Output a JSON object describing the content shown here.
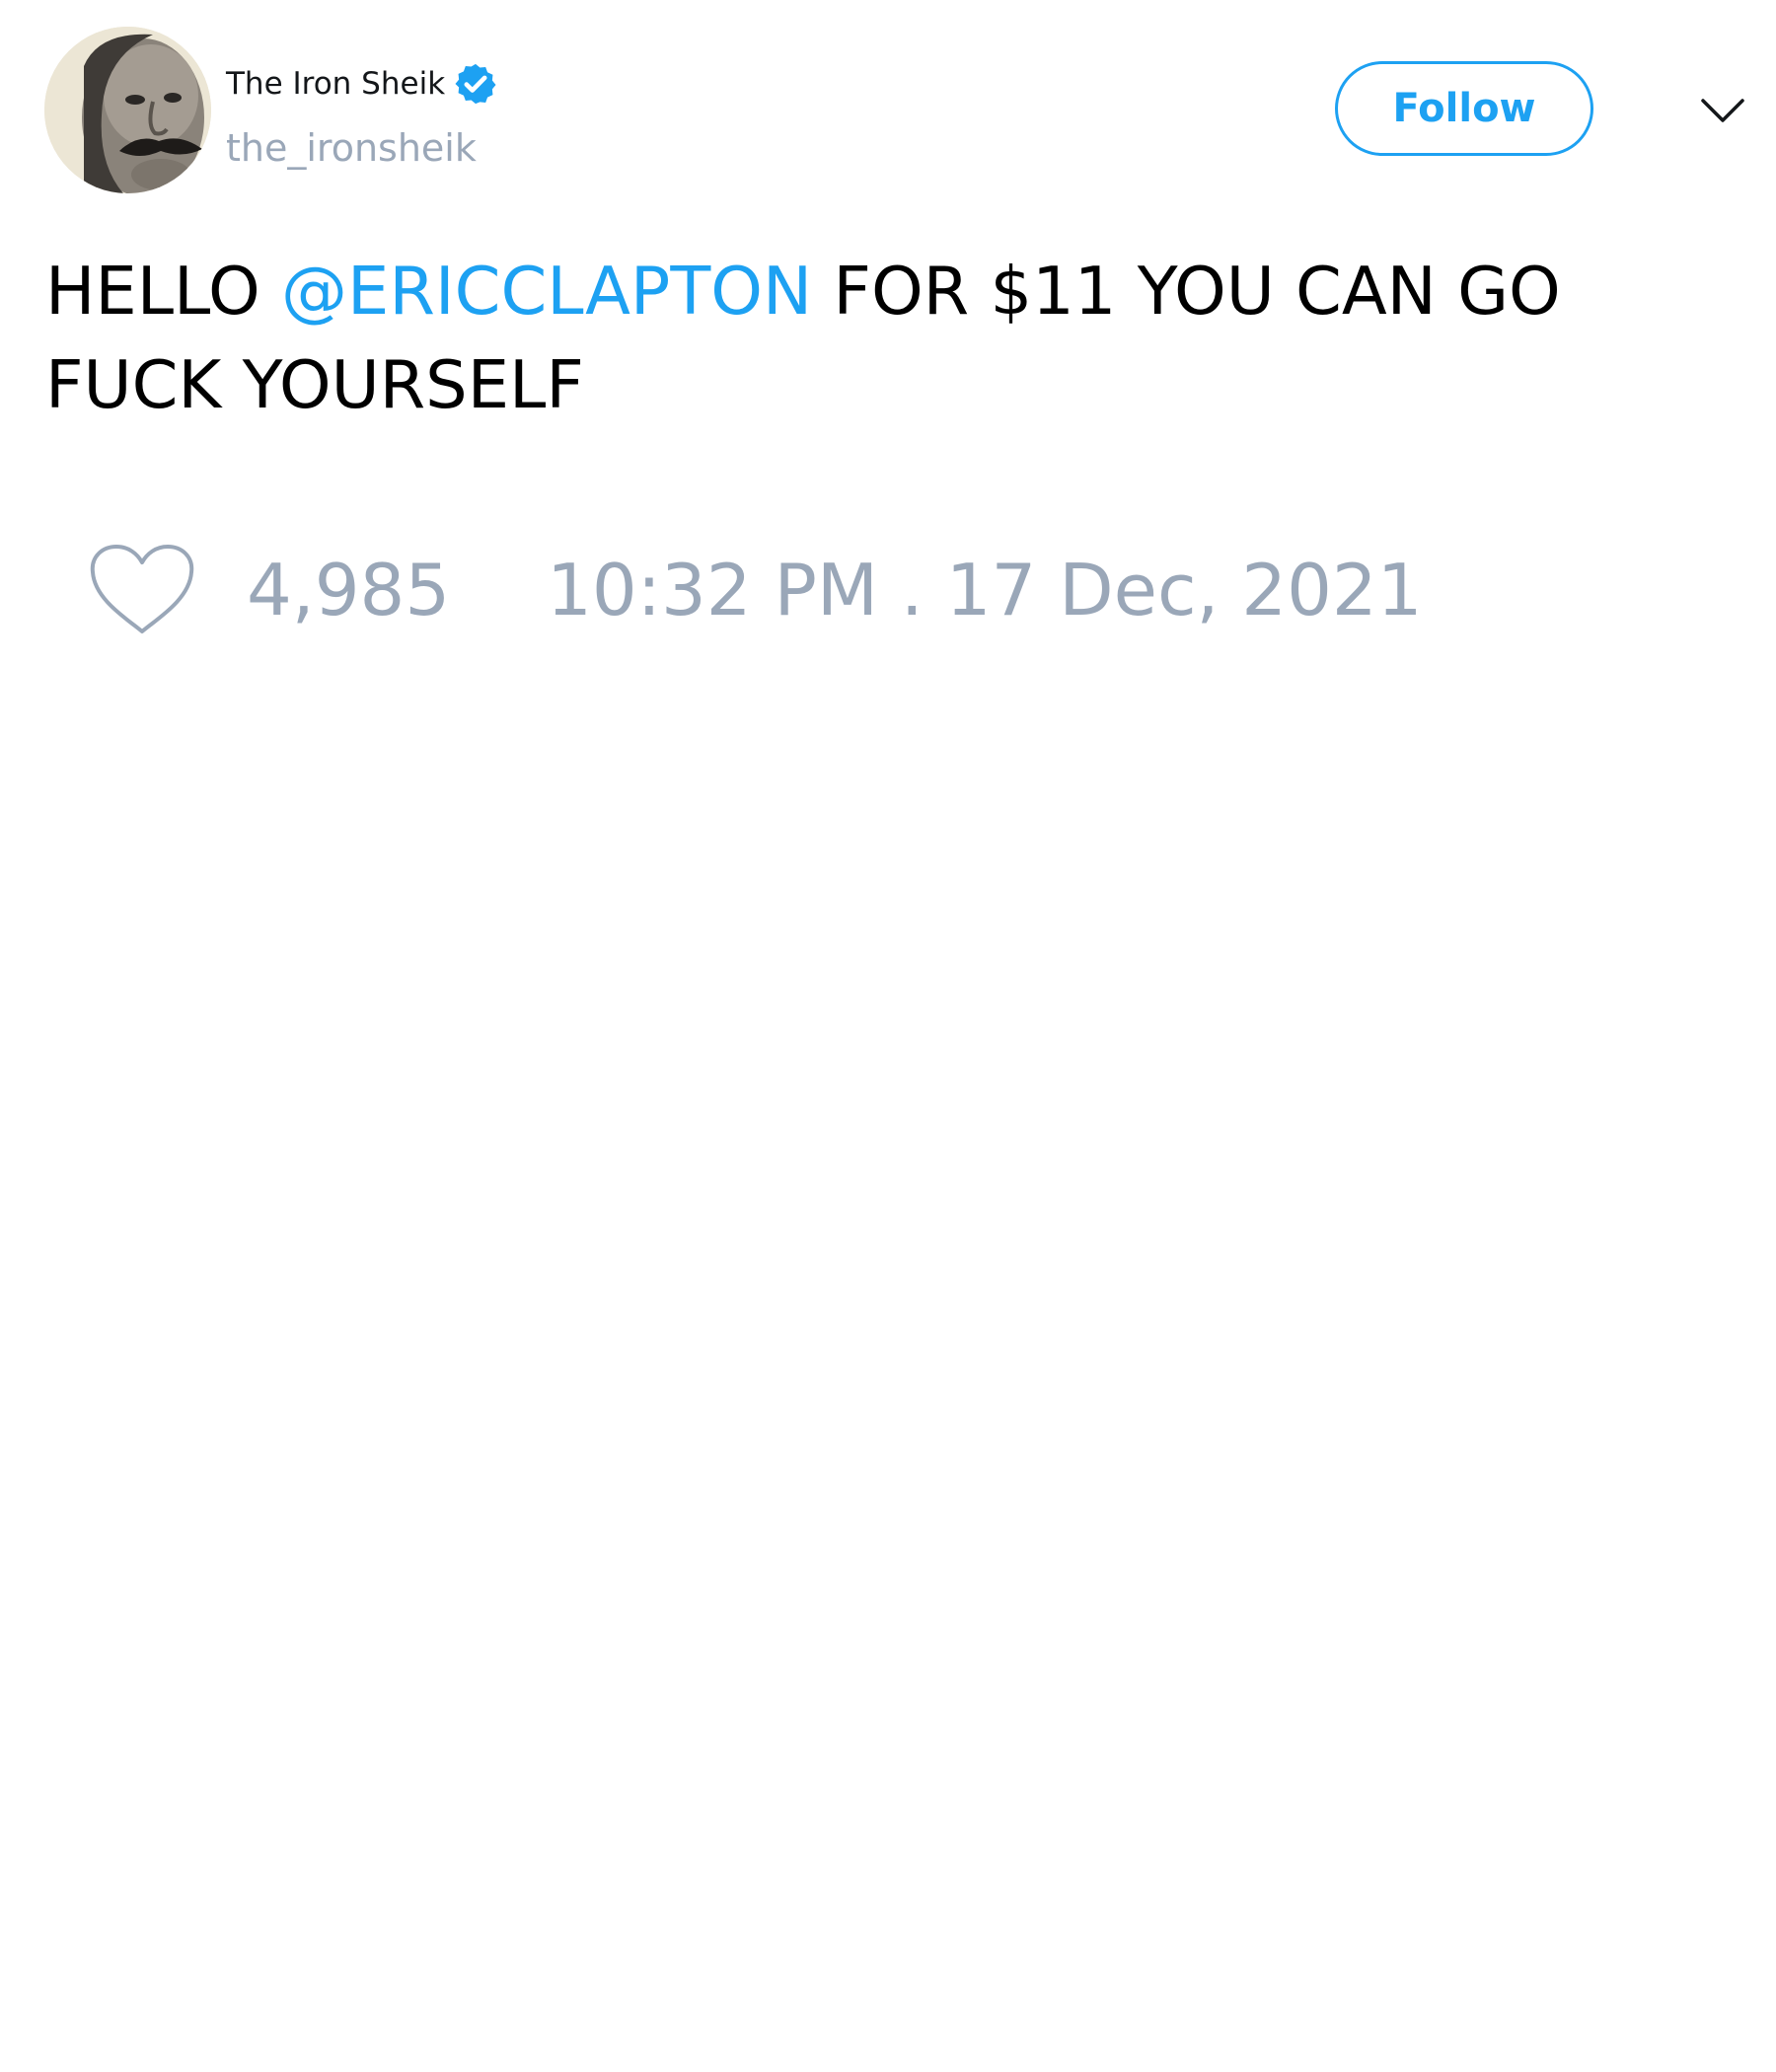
{
  "author": {
    "display_name": "The Iron Sheik",
    "handle": "the_ironsheik",
    "verified": true,
    "avatar_icon": "profile-photo"
  },
  "actions": {
    "follow_label": "Follow",
    "more_icon": "chevron-down-icon"
  },
  "tweet": {
    "text_before_mention": "HELLO ",
    "mention": "@ERICCLAPTON",
    "text_after_mention": " FOR $11 YOU CAN GO FUCK YOURSELF"
  },
  "meta": {
    "like_icon": "heart-icon",
    "like_count": "4,985",
    "timestamp": "10:32 PM . 17 Dec, 2021"
  },
  "colors": {
    "accent": "#1da1f2",
    "muted": "#9aa7b8",
    "text": "#000000",
    "background": "#ffffff"
  }
}
